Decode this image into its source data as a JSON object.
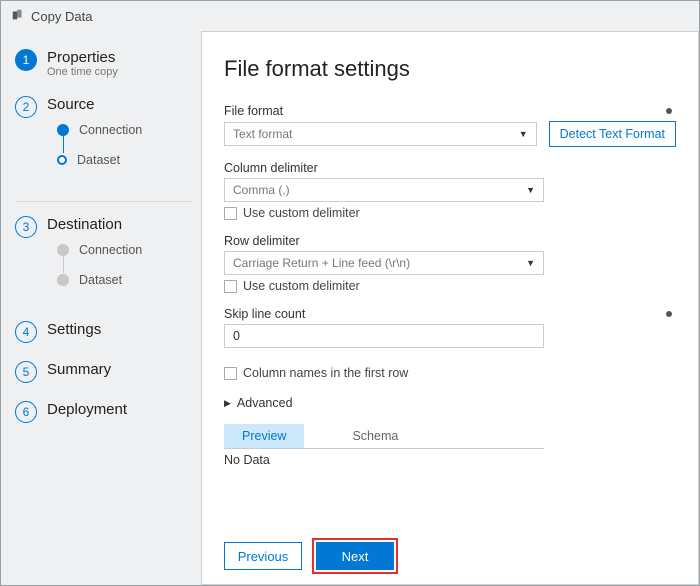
{
  "title": "Copy Data",
  "sidebar": {
    "steps": [
      {
        "num": "1",
        "label": "Properties",
        "sub": "One time copy"
      },
      {
        "num": "2",
        "label": "Source",
        "children": [
          {
            "label": "Connection",
            "state": "done"
          },
          {
            "label": "Dataset",
            "state": "current"
          }
        ]
      },
      {
        "num": "3",
        "label": "Destination",
        "children": [
          {
            "label": "Connection",
            "state": "pending"
          },
          {
            "label": "Dataset",
            "state": "pending"
          }
        ]
      },
      {
        "num": "4",
        "label": "Settings"
      },
      {
        "num": "5",
        "label": "Summary"
      },
      {
        "num": "6",
        "label": "Deployment"
      }
    ]
  },
  "main": {
    "heading": "File format settings",
    "fileFormat": {
      "label": "File format",
      "value": "Text format"
    },
    "detectBtn": "Detect Text Format",
    "columnDelimiter": {
      "label": "Column delimiter",
      "value": "Comma (,)",
      "customLabel": "Use custom delimiter"
    },
    "rowDelimiter": {
      "label": "Row delimiter",
      "value": "Carriage Return + Line feed (\\r\\n)",
      "customLabel": "Use custom delimiter"
    },
    "skipLine": {
      "label": "Skip line count",
      "value": "0"
    },
    "colNamesFirstRow": "Column names in the first row",
    "advanced": "Advanced",
    "tabs": {
      "preview": "Preview",
      "schema": "Schema"
    },
    "noData": "No Data"
  },
  "footer": {
    "previous": "Previous",
    "next": "Next"
  }
}
